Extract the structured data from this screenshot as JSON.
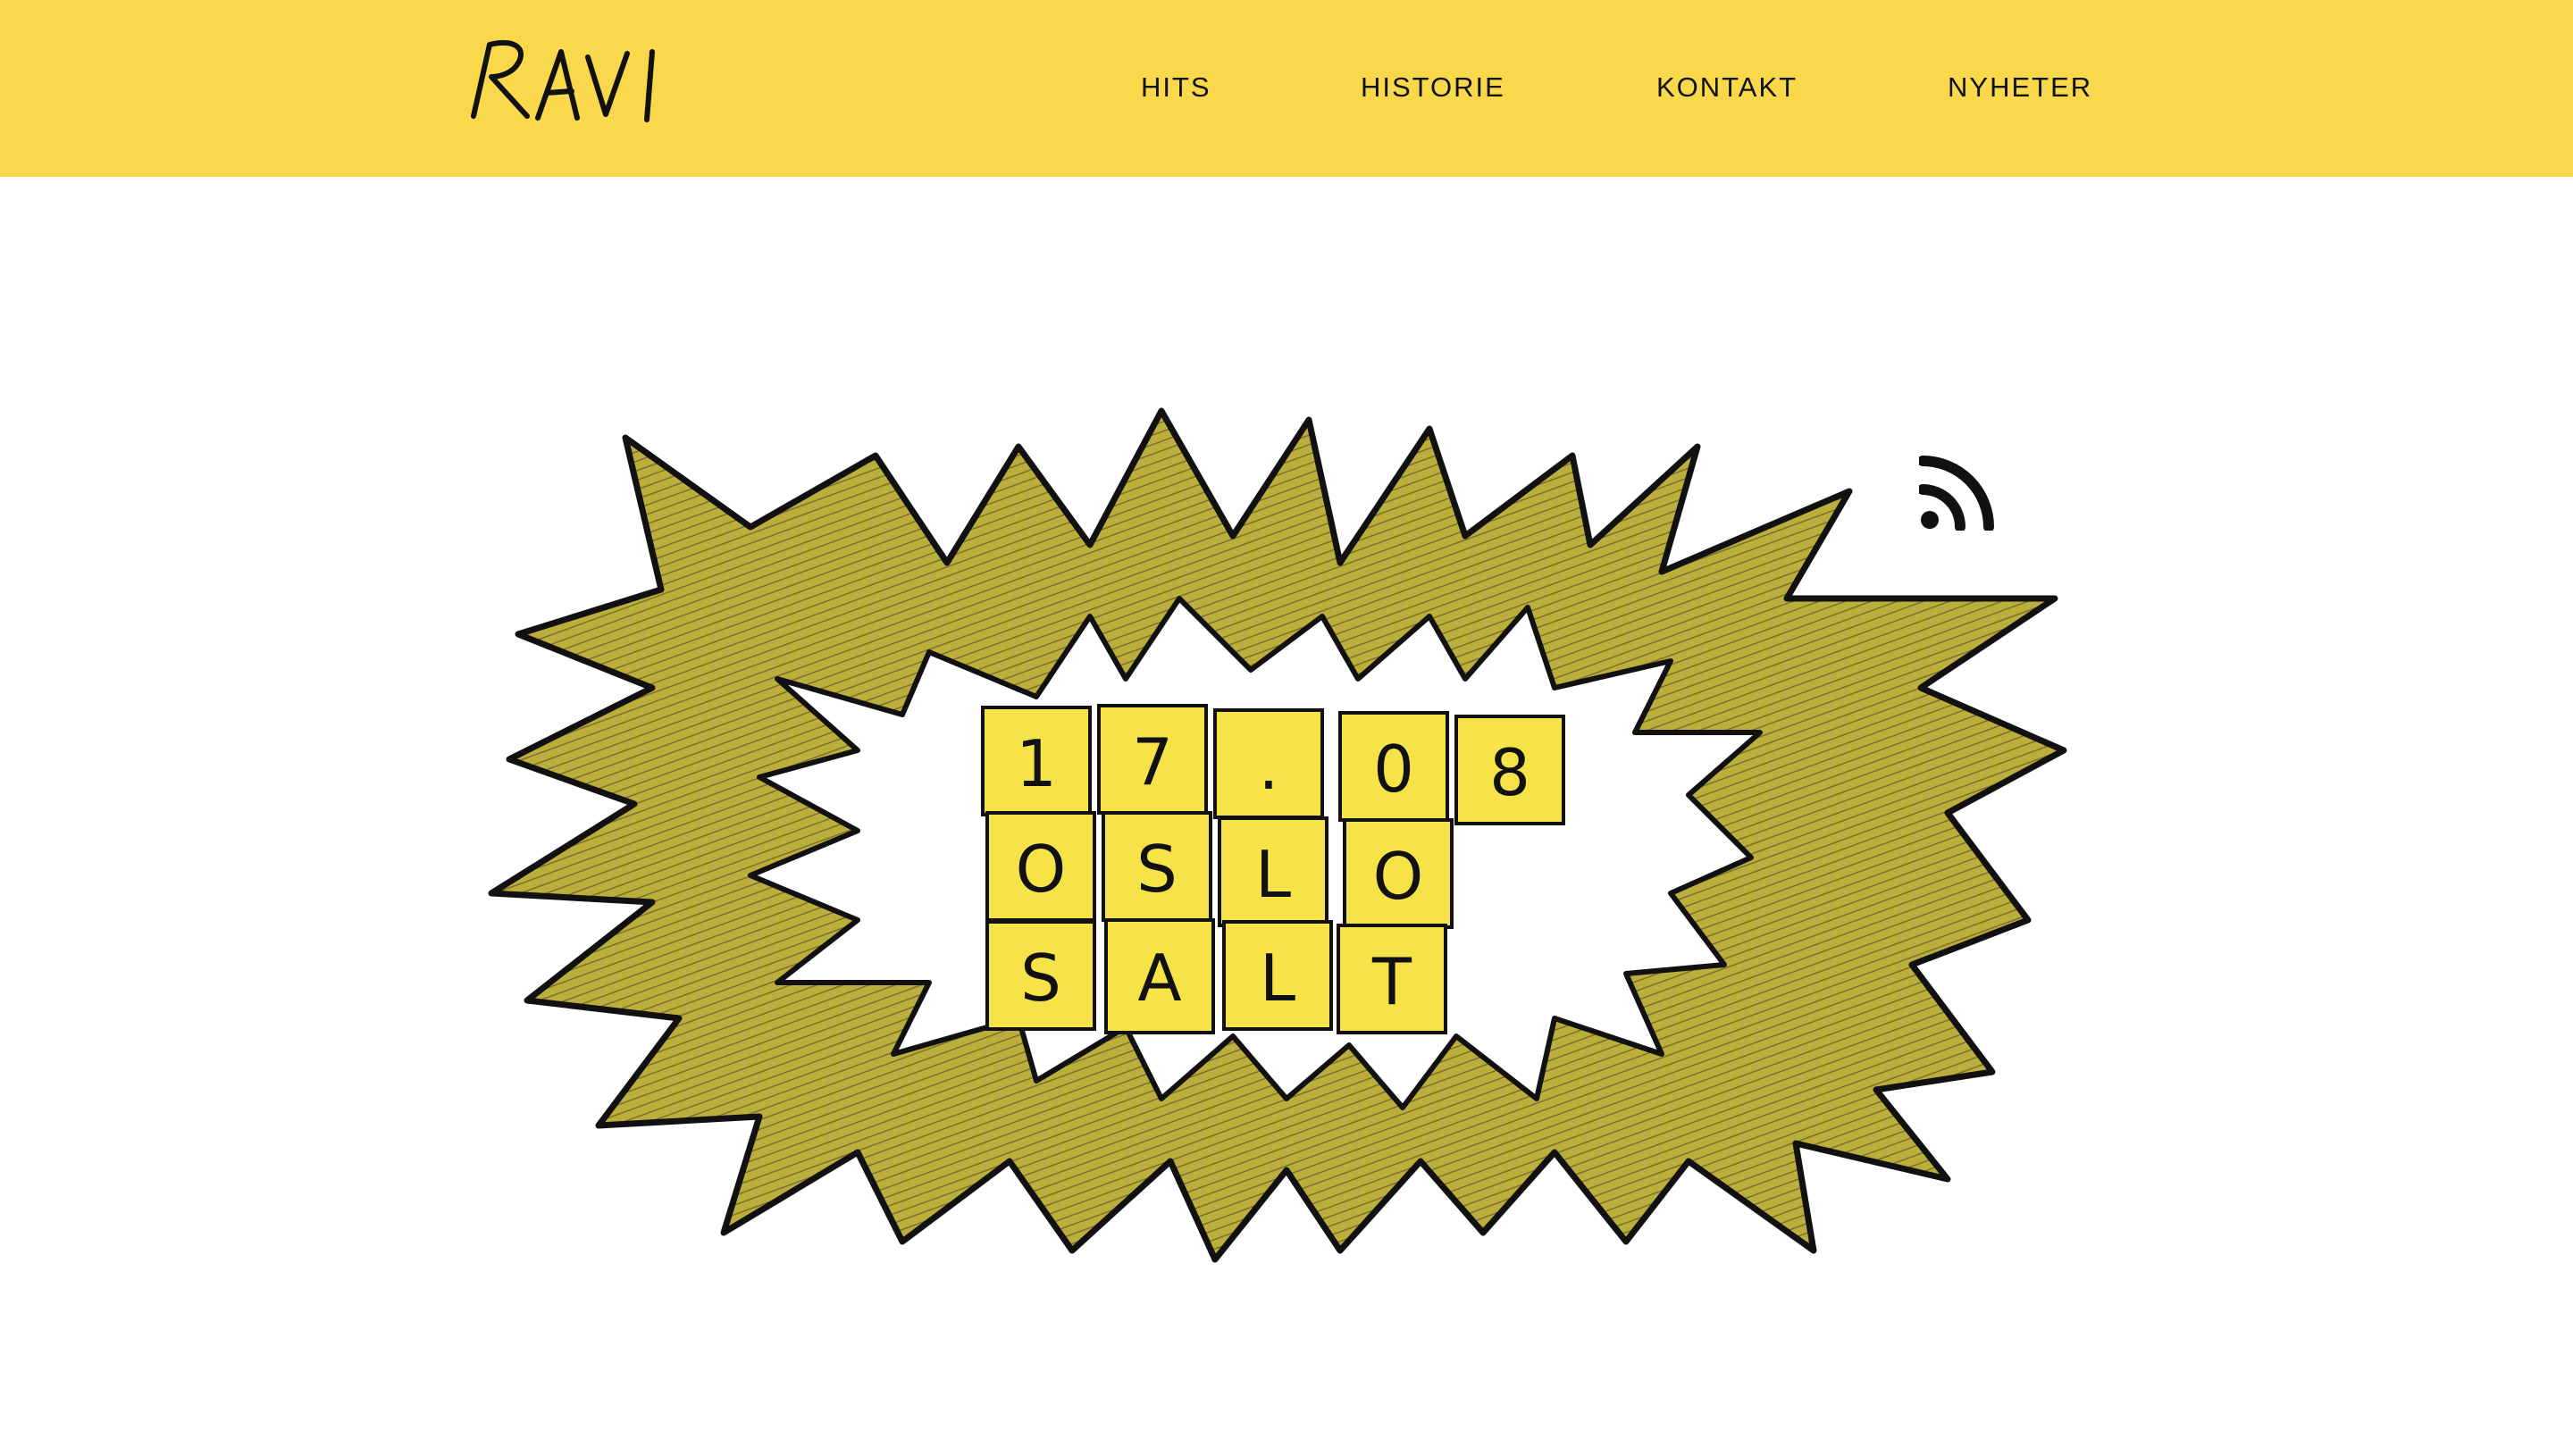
{
  "brand": {
    "logo_text": "RAVI",
    "logo_icon": "handwritten-logo"
  },
  "nav": {
    "items": [
      {
        "label": "HITS"
      },
      {
        "label": "HISTORIE"
      },
      {
        "label": "KONTAKT"
      },
      {
        "label": "NYHETER"
      }
    ]
  },
  "hero": {
    "icon": "explosion-burst-illustration",
    "tiles": {
      "row1": [
        "1",
        "7",
        ".",
        "0",
        "8"
      ],
      "row2": [
        "O",
        "S",
        "L",
        "O"
      ],
      "row3": [
        "S",
        "A",
        "L",
        "T"
      ]
    }
  },
  "rss": {
    "icon": "rss-feed-icon"
  },
  "colors": {
    "header_bg": "#f9d84b",
    "burst_fill": "#b9ad3a",
    "tile_fill": "#f5e347",
    "ink": "#111111"
  }
}
